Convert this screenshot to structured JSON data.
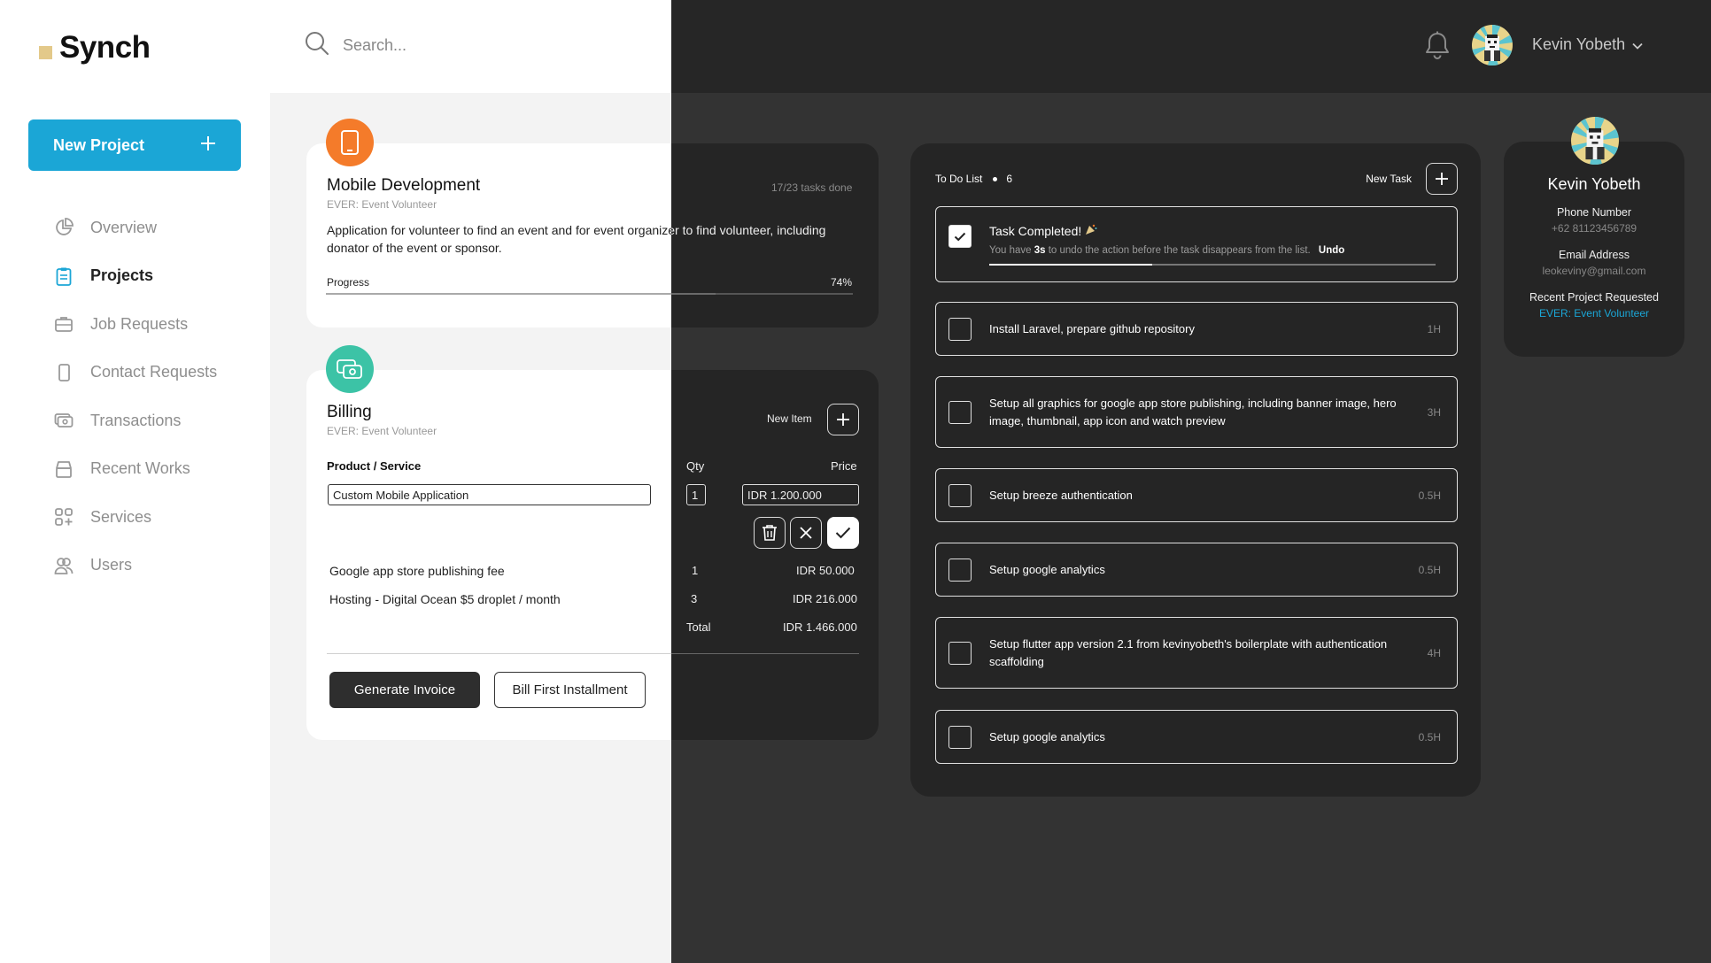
{
  "app": {
    "logo": "Synch"
  },
  "header": {
    "search_placeholder": "Search...",
    "user_name": "Kevin Yobeth"
  },
  "sidebar": {
    "new_project_label": "New Project",
    "items": [
      {
        "label": "Overview",
        "icon": "pie-chart-icon"
      },
      {
        "label": "Projects",
        "icon": "clipboard-icon"
      },
      {
        "label": "Job Requests",
        "icon": "briefcase-icon"
      },
      {
        "label": "Contact Requests",
        "icon": "phone-icon"
      },
      {
        "label": "Transactions",
        "icon": "money-icon"
      },
      {
        "label": "Recent Works",
        "icon": "archive-icon"
      },
      {
        "label": "Services",
        "icon": "grid-plus-icon"
      },
      {
        "label": "Users",
        "icon": "users-icon"
      }
    ],
    "active_index": 1
  },
  "project": {
    "title": "Mobile Development",
    "subtitle": "EVER: Event Volunteer",
    "tasks_done": "17/23 tasks done",
    "description": "Application for volunteer to find an event and for event organizer to find volunteer, including donator of the event or sponsor.",
    "progress_label": "Progress",
    "progress_text": "74%",
    "progress_value": 0.74
  },
  "billing": {
    "title": "Billing",
    "subtitle": "EVER: Event Volunteer",
    "new_item_label": "New Item",
    "col_product": "Product / Service",
    "col_qty": "Qty",
    "col_price": "Price",
    "edit_product": "Custom Mobile Application",
    "edit_qty": "1",
    "edit_price": "IDR 1.200.000",
    "rows": [
      {
        "name": "Google app store publishing fee",
        "qty": "1",
        "price": "IDR 50.000"
      },
      {
        "name": "Hosting - Digital Ocean $5 droplet / month",
        "qty": "3",
        "price": "IDR 216.000"
      }
    ],
    "total_label": "Total",
    "total_value": "IDR 1.466.000",
    "generate_label": "Generate Invoice",
    "bill_label": "Bill First Installment"
  },
  "todo": {
    "title": "To Do List",
    "count": "6",
    "new_task_label": "New Task",
    "completed": {
      "title": "Task Completed!",
      "message_pre": "You have ",
      "message_bold": "3s",
      "message_post": " to undo the action before the task disappears from the list.",
      "undo_label": "Undo"
    },
    "tasks": [
      {
        "text": "Install Laravel, prepare github repository",
        "duration": "1H"
      },
      {
        "text": "Setup all graphics for google app store publishing, including banner image, hero image, thumbnail, app icon and watch preview",
        "duration": "3H"
      },
      {
        "text": "Setup breeze authentication",
        "duration": "0.5H"
      },
      {
        "text": "Setup google analytics",
        "duration": "0.5H"
      },
      {
        "text": "Setup flutter app version 2.1 from kevinyobeth's boilerplate with authentication scaffolding",
        "duration": "4H"
      },
      {
        "text": "Setup google analytics",
        "duration": "0.5H"
      }
    ]
  },
  "profile": {
    "name": "Kevin Yobeth",
    "phone_label": "Phone Number",
    "phone": "+62 81123456789",
    "email_label": "Email Address",
    "email": "leokeviny@gmail.com",
    "recent_label": "Recent Project Requested",
    "recent_project": "EVER: Event Volunteer"
  },
  "colors": {
    "accent": "#1ba6d6",
    "logo_mark": "#e3c98a",
    "project_icon": "#f47b2a",
    "billing_icon": "#3cc3a6"
  }
}
